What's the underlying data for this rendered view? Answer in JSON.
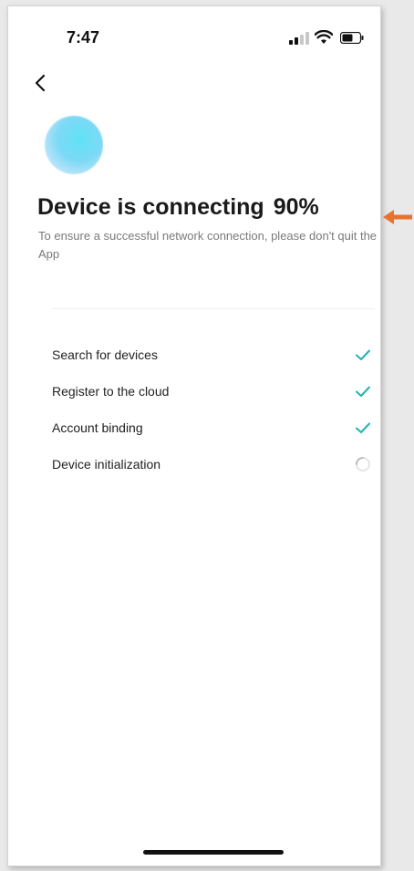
{
  "status_bar": {
    "time": "7:47",
    "icons": [
      "cellular-signal-icon",
      "wifi-icon",
      "battery-icon"
    ]
  },
  "nav": {
    "back_icon": "chevron-left-icon"
  },
  "header": {
    "title": "Device is connecting",
    "percent": "90%",
    "progress_fraction": 0.9,
    "subtitle": "To ensure a successful network connection, please don't quit the App"
  },
  "steps": [
    {
      "label": "Search for devices",
      "status": "done",
      "icon": "check-icon"
    },
    {
      "label": "Register to the cloud",
      "status": "done",
      "icon": "check-icon"
    },
    {
      "label": "Account binding",
      "status": "done",
      "icon": "check-icon"
    },
    {
      "label": "Device initialization",
      "status": "in-progress",
      "icon": "spinner-icon"
    }
  ],
  "colors": {
    "accent": "#1fb4b0",
    "annotation_arrow": "#e8732f",
    "title": "#1a1a1a",
    "subtitle": "#7a7a7a"
  }
}
